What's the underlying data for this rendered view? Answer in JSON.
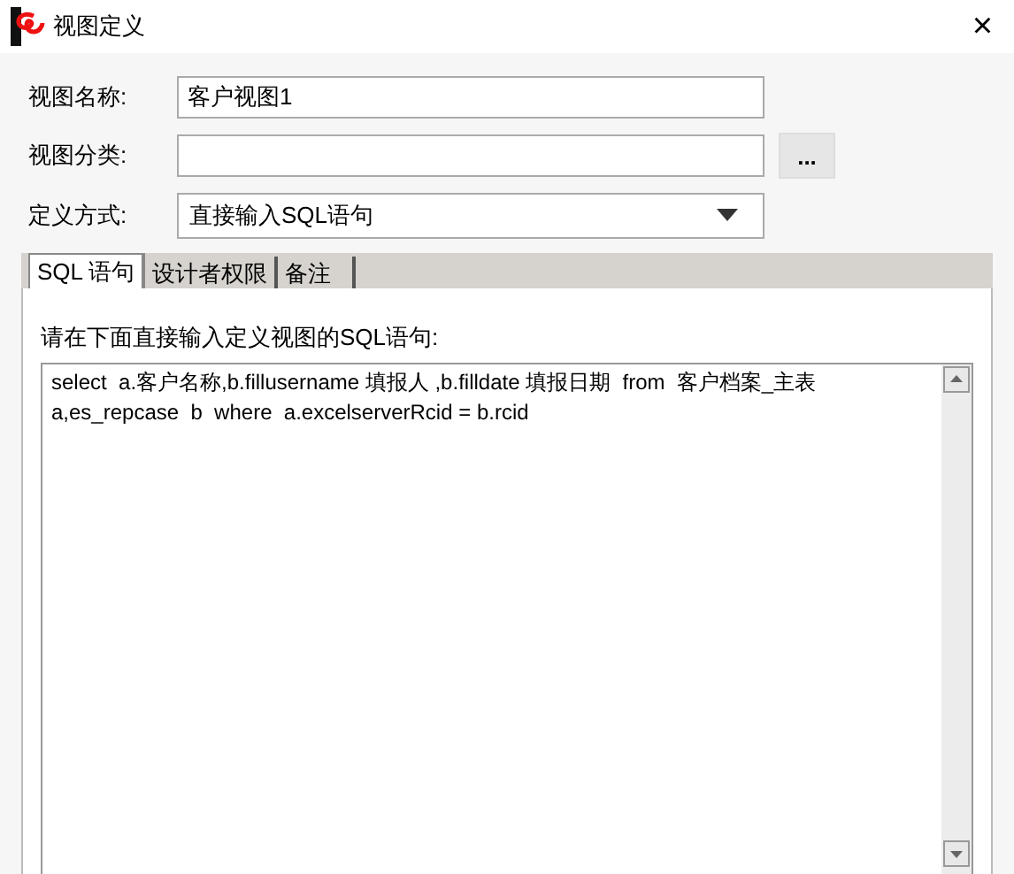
{
  "window": {
    "title": "视图定义",
    "close": "×"
  },
  "fields": [
    {
      "label": "视图名称:",
      "kind": "text",
      "value": "客户视图1"
    },
    {
      "label": "视图分类:",
      "kind": "browse",
      "button": "..."
    },
    {
      "label": "定义方式:",
      "kind": "select",
      "value": "直接输入SQL语句"
    }
  ],
  "tabs": [
    {
      "label": "SQL 语句",
      "selected": true
    },
    {
      "label": "设计者权限",
      "selected": false
    },
    {
      "label": "备注",
      "selected": false
    }
  ],
  "instruction": "请在下面直接输入定义视图的SQL语句:",
  "sql": "select  a.客户名称,b.fillusername 填报人 ,b.filldate 填报日期  from  客户档案_主表\na,es_repcase  b  where  a.excelserverRcid = b.rcid"
}
